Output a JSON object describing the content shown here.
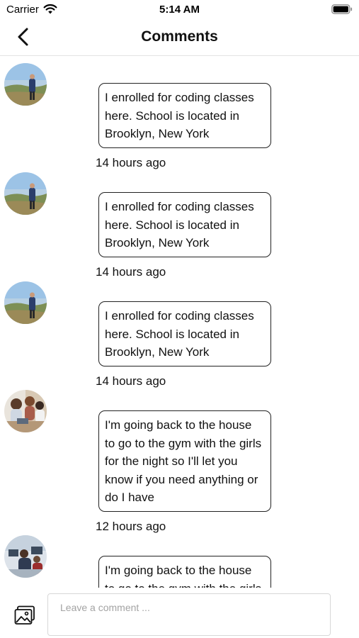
{
  "status_bar": {
    "carrier": "Carrier",
    "time": "5:14 AM"
  },
  "nav": {
    "title": "Comments",
    "back_icon": "chevron-left-icon"
  },
  "comments": [
    {
      "avatar": "landscape-person-photo",
      "text": "I enrolled for coding classes here. School is located in Brooklyn, New York",
      "time_ago": "14 hours ago"
    },
    {
      "avatar": "landscape-person-photo",
      "text": "I enrolled for coding classes here. School is located in Brooklyn, New York",
      "time_ago": "14 hours ago"
    },
    {
      "avatar": "landscape-person-photo",
      "text": "I enrolled for coding classes here. School is located in Brooklyn, New York",
      "time_ago": "14 hours ago"
    },
    {
      "avatar": "group-people-photo",
      "text": "I'm going back to the house to go to the gym with the girls for the night so I'll let you know if you need anything or do I have",
      "time_ago": "12 hours ago"
    },
    {
      "avatar": "office-people-photo",
      "text": "I'm going back to the house to go to the gym with the girls for the night so I'll let you know if you need anything or do I have",
      "time_ago": ""
    }
  ],
  "composer": {
    "image_icon": "image-icon",
    "placeholder": "Leave a comment ..."
  }
}
